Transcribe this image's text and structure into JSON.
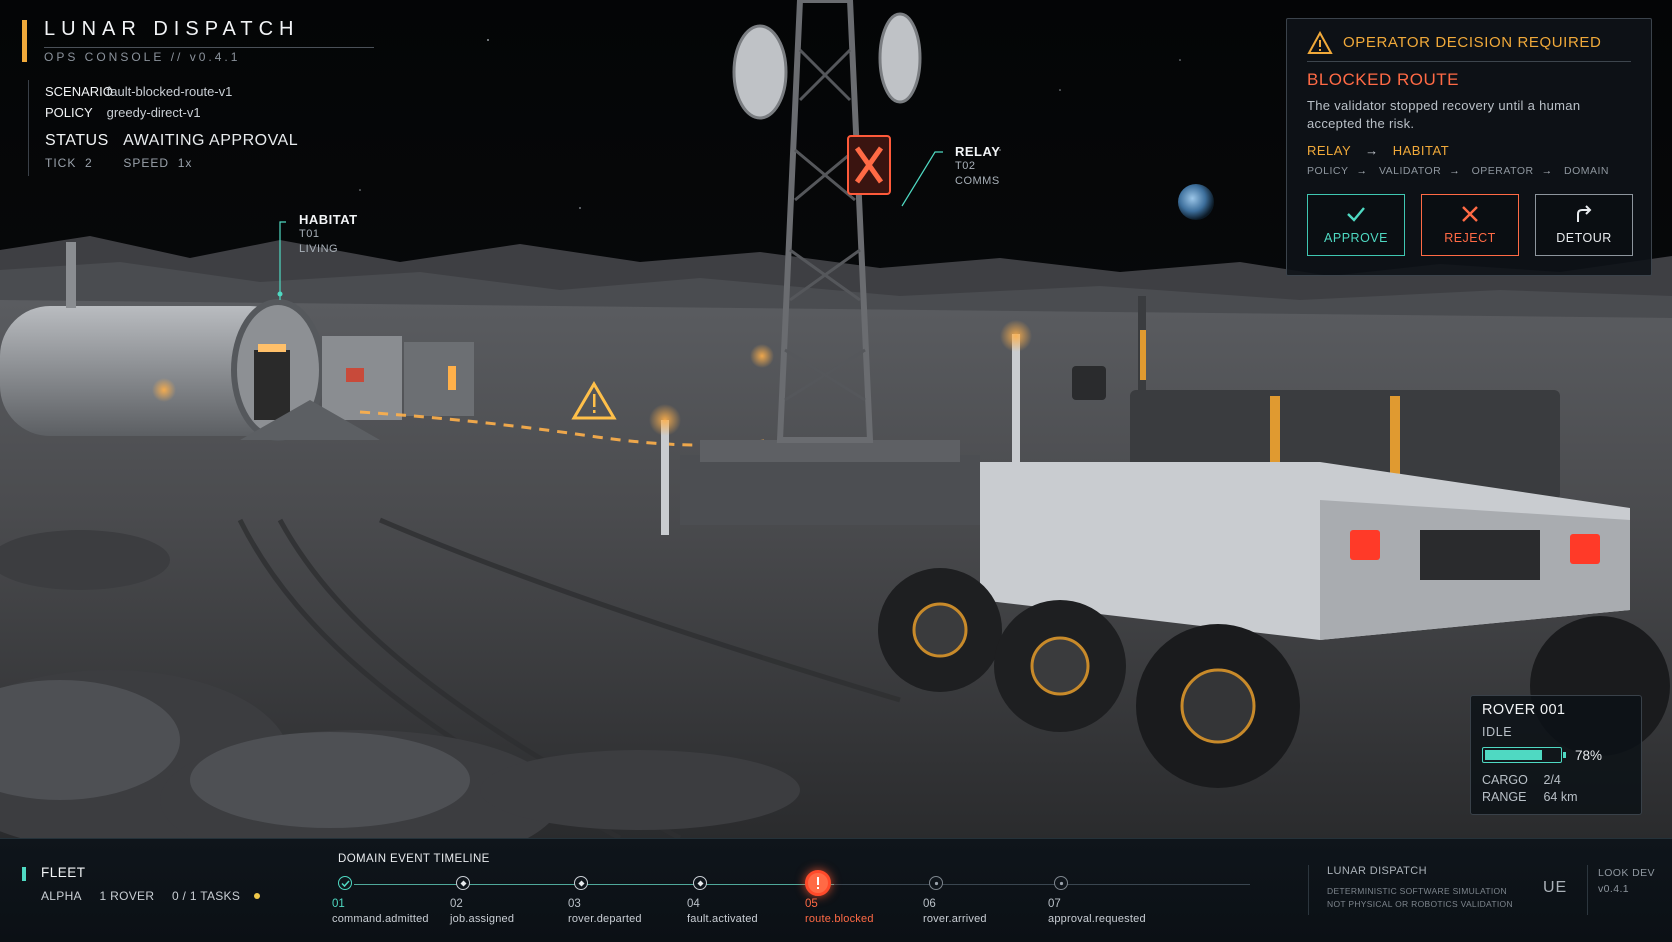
{
  "brand": {
    "title": "LUNAR DISPATCH",
    "subtitle": "OPS CONSOLE   //   v0.4.1"
  },
  "info": {
    "scenario_label": "SCENARIO",
    "scenario": "fault-blocked-route-v1",
    "policy_label": "POLICY",
    "policy": "greedy-direct-v1",
    "status_label": "STATUS",
    "status": "AWAITING APPROVAL",
    "tick_label": "TICK",
    "tick": "2",
    "speed_label": "SPEED",
    "speed": "1x"
  },
  "scene_labels": {
    "habitat": {
      "name": "HABITAT",
      "id": "T01",
      "type": "LIVING"
    },
    "relay": {
      "name": "RELAY",
      "id": "T02",
      "type": "COMMS"
    }
  },
  "decision": {
    "header": "OPERATOR DECISION REQUIRED",
    "title": "BLOCKED ROUTE",
    "description": "The validator stopped recovery until a human accepted the risk.",
    "route_from": "RELAY",
    "route_arrow": "→",
    "route_to": "HABITAT",
    "path": [
      "POLICY",
      "VALIDATOR",
      "OPERATOR",
      "DOMAIN"
    ],
    "buttons": {
      "approve": "APPROVE",
      "reject": "REJECT",
      "detour": "DETOUR"
    }
  },
  "rover": {
    "name": "ROVER 001",
    "state": "IDLE",
    "battery_percent": 78,
    "battery_label": "78%",
    "cargo_label": "CARGO",
    "cargo": "2/4",
    "range_label": "RANGE",
    "range": "64 km"
  },
  "fleet": {
    "title": "FLEET",
    "name": "ALPHA",
    "rovers": "1 ROVER",
    "tasks": "0 / 1 TASKS"
  },
  "timeline": {
    "title": "DOMAIN EVENT TIMELINE",
    "events": [
      {
        "num": "01",
        "label": "command.admitted",
        "state": "done"
      },
      {
        "num": "02",
        "label": "job.assigned",
        "state": "passed"
      },
      {
        "num": "03",
        "label": "rover.departed",
        "state": "passed"
      },
      {
        "num": "04",
        "label": "fault.activated",
        "state": "passed"
      },
      {
        "num": "05",
        "label": "route.blocked",
        "state": "active"
      },
      {
        "num": "06",
        "label": "rover.arrived",
        "state": "pending"
      },
      {
        "num": "07",
        "label": "approval.requested",
        "state": "pending"
      }
    ]
  },
  "footer": {
    "title": "LUNAR DISPATCH",
    "line1": "DETERMINISTIC SOFTWARE SIMULATION",
    "line2": "NOT PHYSICAL OR ROBOTICS VALIDATION",
    "engine": "UE",
    "build_label": "LOOK DEV",
    "build": "v0.4.1"
  },
  "colors": {
    "accent_teal": "#4fd9c2",
    "warning_amber": "#f0a93a",
    "alert_red": "#ff6a45"
  }
}
